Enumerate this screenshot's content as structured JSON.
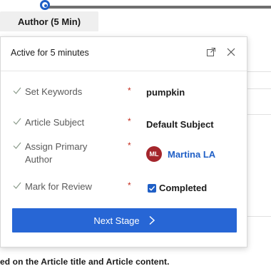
{
  "stage_bar": {
    "active_stage_label": "Author  (5 Min)"
  },
  "flyout": {
    "title": "Active for 5 minutes",
    "expand_icon": "expand-icon",
    "close_icon": "close-icon",
    "steps": [
      {
        "label": "Set Keywords",
        "required_mark": "*",
        "value": "pumpkin",
        "check_icon": "checkmark-icon"
      },
      {
        "label": "Article Subject",
        "required_mark": "*",
        "value": "Default Subject",
        "check_icon": "checkmark-icon"
      },
      {
        "label": "Assign Primary Author",
        "required_mark": "*",
        "avatar_initials": "ML",
        "value": "Martina LA",
        "check_icon": "checkmark-icon"
      },
      {
        "label": "Mark for Review",
        "required_mark": "*",
        "checkbox_checked": true,
        "value": "Completed",
        "check_icon": "checkmark-icon"
      }
    ],
    "next_button_label": "Next Stage",
    "next_button_icon": "chevron-right-icon"
  },
  "background": {
    "caption": "ed on the Article title and Article content."
  },
  "colors": {
    "accent_blue": "#2766d5",
    "link_blue": "#1f5fc6",
    "avatar_red": "#a4262c",
    "required_red": "#c42b1c"
  }
}
